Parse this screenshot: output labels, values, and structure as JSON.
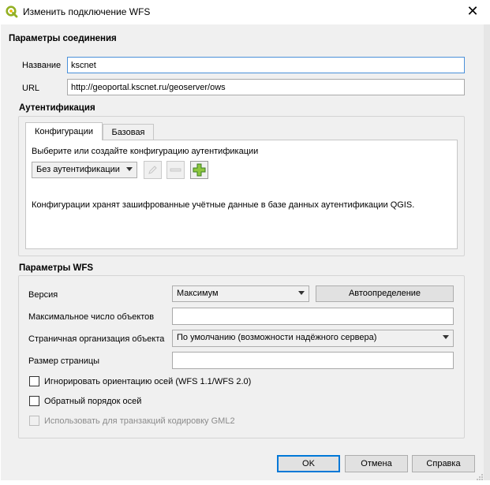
{
  "window": {
    "title": "Изменить подключение WFS",
    "close_glyph": "✕",
    "app_icon": "qgis-logo-icon",
    "accent": "#4a90d9"
  },
  "connection": {
    "section_title": "Параметры соединения",
    "name_label": "Название",
    "name_value": "kscnet",
    "url_label": "URL",
    "url_value": "http://geoportal.kscnet.ru/geoserver/ows"
  },
  "auth": {
    "section_title": "Аутентификация",
    "tabs": [
      "Конфигурации",
      "Базовая"
    ],
    "active_tab": "Конфигурации",
    "select_prompt": "Выберите или создайте конфигурацию аутентификации",
    "config_value": "Без аутентификации",
    "info_text": "Конфигурации хранят зашифрованные учётные данные в базе данных аутентификации QGIS."
  },
  "wfs": {
    "section_title": "Параметры WFS",
    "version_label": "Версия",
    "version_value": "Максимум",
    "detect_button": "Автоопределение",
    "max_features_label": "Максимальное число объектов",
    "max_features_value": "",
    "paging_label": "Страничная организация объекта",
    "paging_value": "По умолчанию (возможности надёжного сервера)",
    "page_size_label": "Размер страницы",
    "page_size_value": "",
    "ignore_axis_label": "Игнорировать ориентацию осей (WFS 1.1/WFS 2.0)",
    "ignore_axis_checked": false,
    "invert_axis_label": "Обратный порядок осей",
    "invert_axis_checked": false,
    "gml2_label": "Использовать для транзакций кодировку GML2",
    "gml2_checked": false,
    "gml2_enabled": false
  },
  "buttons": {
    "ok": "OK",
    "cancel": "Отмена",
    "help": "Справка"
  }
}
